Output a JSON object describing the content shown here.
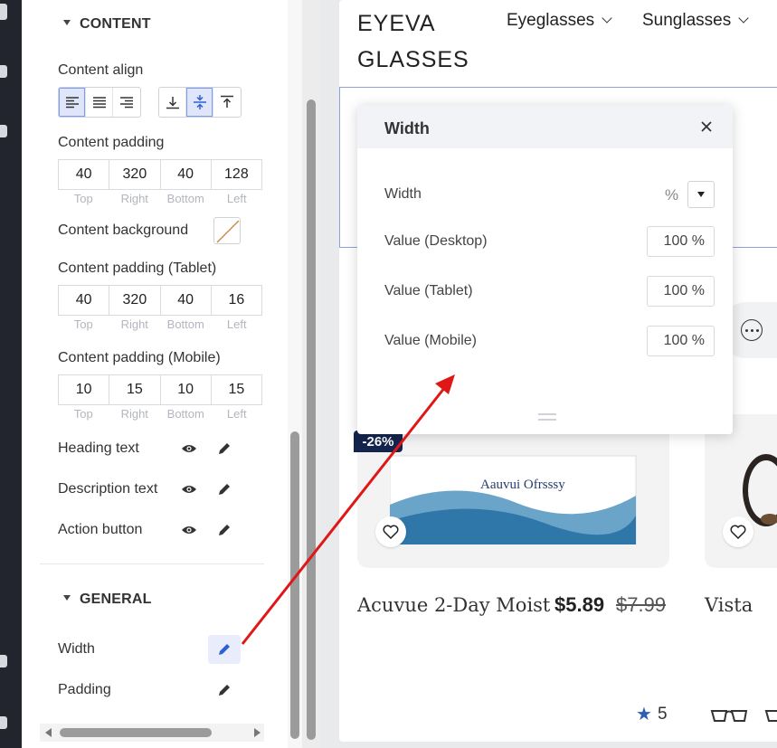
{
  "panel": {
    "content_section_title": "CONTENT",
    "content_align_label": "Content align",
    "padding_caps": [
      "Top",
      "Right",
      "Bottom",
      "Left"
    ],
    "content_padding": {
      "label": "Content padding",
      "values": [
        "40",
        "320",
        "40",
        "128"
      ]
    },
    "content_background_label": "Content background",
    "content_padding_tablet": {
      "label": "Content padding (Tablet)",
      "values": [
        "40",
        "320",
        "40",
        "16"
      ]
    },
    "content_padding_mobile": {
      "label": "Content padding (Mobile)",
      "values": [
        "10",
        "15",
        "10",
        "15"
      ]
    },
    "heading_text_label": "Heading text",
    "description_text_label": "Description text",
    "action_button_label": "Action button",
    "general_section_title": "GENERAL",
    "width_label": "Width",
    "padding_label": "Padding"
  },
  "site": {
    "logo": "EYEVA GLASSES",
    "nav": [
      "Eyeglasses",
      "Sunglasses"
    ],
    "badge": "-26%",
    "product_name": "Acuvue 2-Day Moist",
    "price": "$5.89",
    "old_price": "$7.99",
    "product2_name": "Vista",
    "rating": "5",
    "product_box_text": "Aauvui Ofrsssy"
  },
  "popup": {
    "title": "Width",
    "width_label": "Width",
    "unit": "%",
    "desktop_label": "Value (Desktop)",
    "desktop_value": "100 %",
    "tablet_label": "Value (Tablet)",
    "tablet_value": "100 %",
    "mobile_label": "Value (Mobile)",
    "mobile_value": "100 %"
  },
  "colors": {
    "accent": "#2f5fd6",
    "arrow": "#e01717",
    "rail": "#23252e",
    "badge": "#14254d",
    "star": "#2d5fb4"
  },
  "icons": [
    "eye-icon",
    "pencil-icon",
    "close-icon",
    "heart-icon",
    "more-icon",
    "chevron-down-icon",
    "star-icon",
    "glasses-icon"
  ]
}
